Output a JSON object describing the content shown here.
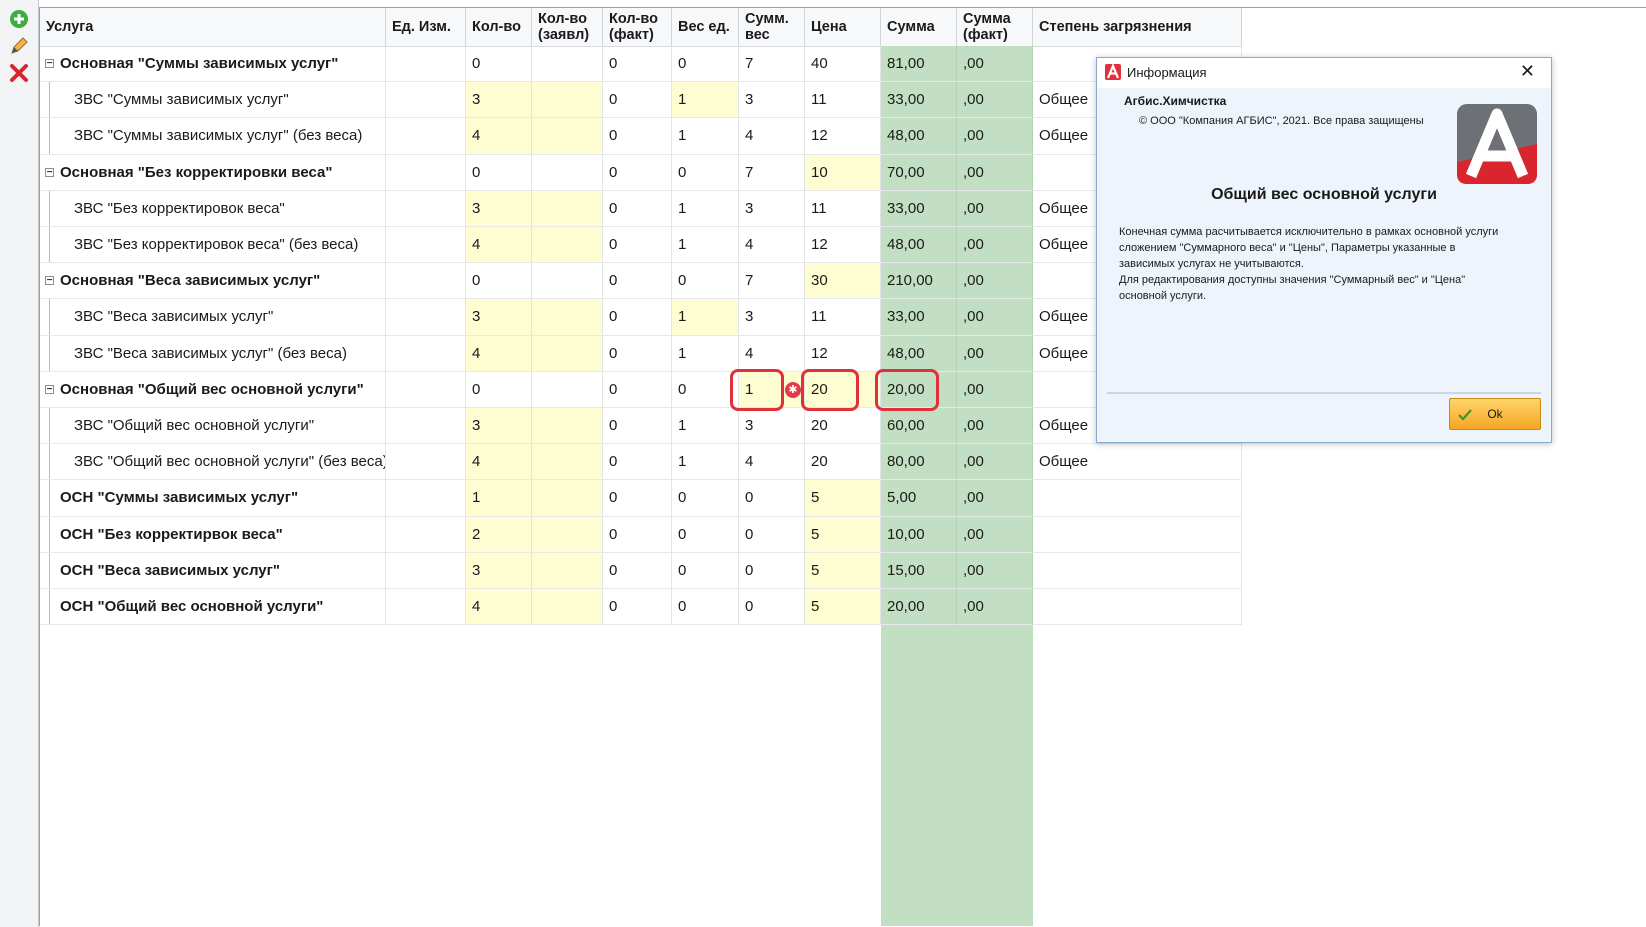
{
  "toolbar": {
    "add_icon": "plus-circle-icon",
    "edit_icon": "pencil-icon",
    "delete_icon": "red-x-icon"
  },
  "columns": [
    "Услуга",
    "Ед. Изм.",
    "Кол-во",
    "Кол-во (заявл)",
    "Кол-во (факт)",
    "Вес ед.",
    "Сумм. вес",
    "Цена",
    "Сумма",
    "Сумма (факт)",
    "Степень загрязнения"
  ],
  "rows": [
    {
      "service": "Основная \"Суммы зависимых услуг\"",
      "unit": "",
      "qty": "0",
      "qty_decl": "",
      "qty_fact": "0",
      "unit_weight": "0",
      "sum_weight": "7",
      "price": "40",
      "sum": "81,00",
      "sum_fact": ",00",
      "dirt": ""
    },
    {
      "service": "ЗВС \"Суммы зависимых услуг\"",
      "unit": "",
      "qty": "3",
      "qty_decl": "",
      "qty_fact": "0",
      "unit_weight": "1",
      "sum_weight": "3",
      "price": "11",
      "sum": "33,00",
      "sum_fact": ",00",
      "dirt": "Общее"
    },
    {
      "service": "ЗВС \"Суммы зависимых услуг\" (без веса)",
      "unit": "",
      "qty": "4",
      "qty_decl": "",
      "qty_fact": "0",
      "unit_weight": "1",
      "sum_weight": "4",
      "price": "12",
      "sum": "48,00",
      "sum_fact": ",00",
      "dirt": "Общее"
    },
    {
      "service": "Основная \"Без корректировки веса\"",
      "unit": "",
      "qty": "0",
      "qty_decl": "",
      "qty_fact": "0",
      "unit_weight": "0",
      "sum_weight": "7",
      "price": "10",
      "sum": "70,00",
      "sum_fact": ",00",
      "dirt": ""
    },
    {
      "service": "ЗВС \"Без корректировок веса\"",
      "unit": "",
      "qty": "3",
      "qty_decl": "",
      "qty_fact": "0",
      "unit_weight": "1",
      "sum_weight": "3",
      "price": "11",
      "sum": "33,00",
      "sum_fact": ",00",
      "dirt": "Общее"
    },
    {
      "service": "ЗВС \"Без корректировок веса\" (без веса)",
      "unit": "",
      "qty": "4",
      "qty_decl": "",
      "qty_fact": "0",
      "unit_weight": "1",
      "sum_weight": "4",
      "price": "12",
      "sum": "48,00",
      "sum_fact": ",00",
      "dirt": "Общее"
    },
    {
      "service": "Основная \"Веса зависимых услуг\"",
      "unit": "",
      "qty": "0",
      "qty_decl": "",
      "qty_fact": "0",
      "unit_weight": "0",
      "sum_weight": "7",
      "price": "30",
      "sum": "210,00",
      "sum_fact": ",00",
      "dirt": ""
    },
    {
      "service": "ЗВС \"Веса зависимых услуг\"",
      "unit": "",
      "qty": "3",
      "qty_decl": "",
      "qty_fact": "0",
      "unit_weight": "1",
      "sum_weight": "3",
      "price": "11",
      "sum": "33,00",
      "sum_fact": ",00",
      "dirt": "Общее"
    },
    {
      "service": "ЗВС \"Веса зависимых услуг\" (без веса)",
      "unit": "",
      "qty": "4",
      "qty_decl": "",
      "qty_fact": "0",
      "unit_weight": "1",
      "sum_weight": "4",
      "price": "12",
      "sum": "48,00",
      "sum_fact": ",00",
      "dirt": "Общее"
    },
    {
      "service": "Основная \"Общий вес основной услуги\"",
      "unit": "",
      "qty": "0",
      "qty_decl": "",
      "qty_fact": "0",
      "unit_weight": "0",
      "sum_weight": "1",
      "price": "20",
      "sum": "20,00",
      "sum_fact": ",00",
      "dirt": ""
    },
    {
      "service": "ЗВС \"Общий вес основной услуги\"",
      "unit": "",
      "qty": "3",
      "qty_decl": "",
      "qty_fact": "0",
      "unit_weight": "1",
      "sum_weight": "3",
      "price": "20",
      "sum": "60,00",
      "sum_fact": ",00",
      "dirt": "Общее"
    },
    {
      "service": "ЗВС \"Общий вес основной услуги\" (без веса)",
      "unit": "",
      "qty": "4",
      "qty_decl": "",
      "qty_fact": "0",
      "unit_weight": "1",
      "sum_weight": "4",
      "price": "20",
      "sum": "80,00",
      "sum_fact": ",00",
      "dirt": "Общее"
    },
    {
      "service": "ОСН \"Суммы зависимых услуг\"",
      "unit": "",
      "qty": "1",
      "qty_decl": "",
      "qty_fact": "0",
      "unit_weight": "0",
      "sum_weight": "0",
      "price": "5",
      "sum": "5,00",
      "sum_fact": ",00",
      "dirt": ""
    },
    {
      "service": "ОСН \"Без корректирвок веса\"",
      "unit": "",
      "qty": "2",
      "qty_decl": "",
      "qty_fact": "0",
      "unit_weight": "0",
      "sum_weight": "0",
      "price": "5",
      "sum": "10,00",
      "sum_fact": ",00",
      "dirt": ""
    },
    {
      "service": "ОСН \"Веса зависимых услуг\"",
      "unit": "",
      "qty": "3",
      "qty_decl": "",
      "qty_fact": "0",
      "unit_weight": "0",
      "sum_weight": "0",
      "price": "5",
      "sum": "15,00",
      "sum_fact": ",00",
      "dirt": ""
    },
    {
      "service": "ОСН \"Общий вес основной услуги\"",
      "unit": "",
      "qty": "4",
      "qty_decl": "",
      "qty_fact": "0",
      "unit_weight": "0",
      "sum_weight": "0",
      "price": "5",
      "sum": "20,00",
      "sum_fact": ",00",
      "dirt": ""
    }
  ],
  "dialog": {
    "title": "Информация",
    "close_glyph": "✕",
    "app_name": "Агбис.Химчистка",
    "copyright": "© ООО \"Компания АГБИС\", 2021. Все права защищены",
    "heading": "Общий вес основной услуги",
    "body_lines": [
      "Конечная сумма расчитывается исключительно в рамках основной услуги",
      "сложением \"Суммарного веса\" и \"Цены\", Параметры указанные в",
      "зависимых услугах не учитываются.",
      "Для редактирования доступны значения \"Суммарный вес\" и \"Цена\"",
      "основной услуги."
    ],
    "ok_label": "Ok"
  },
  "colors": {
    "accent_red": "#e0303a",
    "editable_yellow": "#fdfdd1",
    "sum_green": "#c3dfc3",
    "ok_orange": "#f6a623"
  }
}
